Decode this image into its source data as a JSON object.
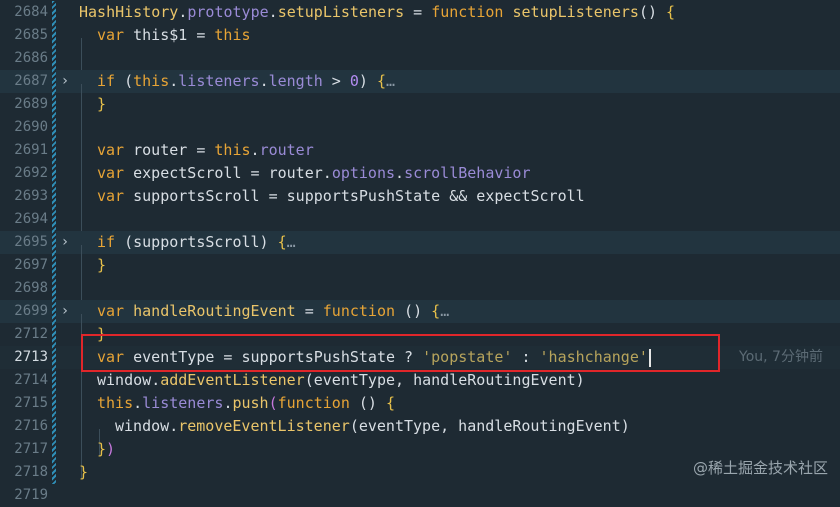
{
  "editor": {
    "lines": [
      {
        "num": "2684",
        "indent": 0,
        "fold": false,
        "tokens": [
          {
            "t": "HashHistory",
            "c": "fn"
          },
          {
            "t": ".",
            "c": "op"
          },
          {
            "t": "prototype",
            "c": "prop"
          },
          {
            "t": ".",
            "c": "op"
          },
          {
            "t": "setupListeners",
            "c": "fn"
          },
          {
            "t": " = ",
            "c": "op"
          },
          {
            "t": "function",
            "c": "kw"
          },
          {
            "t": " setupListeners",
            "c": "fn"
          },
          {
            "t": "() ",
            "c": "op"
          },
          {
            "t": "{",
            "c": "pn"
          }
        ]
      },
      {
        "num": "2685",
        "indent": 1,
        "fold": false,
        "tokens": [
          {
            "t": "var",
            "c": "kw"
          },
          {
            "t": " this$1 = ",
            "c": "id"
          },
          {
            "t": "this",
            "c": "kw"
          }
        ]
      },
      {
        "num": "2686",
        "indent": 1,
        "fold": false,
        "tokens": []
      },
      {
        "num": "2687",
        "indent": 1,
        "fold": true,
        "tokens": [
          {
            "t": "if",
            "c": "kw"
          },
          {
            "t": " (",
            "c": "op"
          },
          {
            "t": "this",
            "c": "kw"
          },
          {
            "t": ".",
            "c": "op"
          },
          {
            "t": "listeners",
            "c": "prop"
          },
          {
            "t": ".",
            "c": "op"
          },
          {
            "t": "length",
            "c": "prop"
          },
          {
            "t": " > ",
            "c": "op"
          },
          {
            "t": "0",
            "c": "num"
          },
          {
            "t": ") ",
            "c": "op"
          },
          {
            "t": "{",
            "c": "pn"
          },
          {
            "t": "…",
            "c": "dots"
          }
        ]
      },
      {
        "num": "2689",
        "indent": 1,
        "fold": false,
        "tokens": [
          {
            "t": "}",
            "c": "pn"
          }
        ]
      },
      {
        "num": "2690",
        "indent": 1,
        "fold": false,
        "tokens": []
      },
      {
        "num": "2691",
        "indent": 1,
        "fold": false,
        "tokens": [
          {
            "t": "var",
            "c": "kw"
          },
          {
            "t": " router = ",
            "c": "id"
          },
          {
            "t": "this",
            "c": "kw"
          },
          {
            "t": ".",
            "c": "op"
          },
          {
            "t": "router",
            "c": "prop"
          }
        ]
      },
      {
        "num": "2692",
        "indent": 1,
        "fold": false,
        "tokens": [
          {
            "t": "var",
            "c": "kw"
          },
          {
            "t": " expectScroll = router.",
            "c": "id"
          },
          {
            "t": "options",
            "c": "prop"
          },
          {
            "t": ".",
            "c": "op"
          },
          {
            "t": "scrollBehavior",
            "c": "prop"
          }
        ]
      },
      {
        "num": "2693",
        "indent": 1,
        "fold": false,
        "tokens": [
          {
            "t": "var",
            "c": "kw"
          },
          {
            "t": " supportsScroll = supportsPushState && expectScroll",
            "c": "id"
          }
        ]
      },
      {
        "num": "2694",
        "indent": 1,
        "fold": false,
        "tokens": []
      },
      {
        "num": "2695",
        "indent": 1,
        "fold": true,
        "tokens": [
          {
            "t": "if",
            "c": "kw"
          },
          {
            "t": " (supportsScroll) ",
            "c": "id"
          },
          {
            "t": "{",
            "c": "pn"
          },
          {
            "t": "…",
            "c": "dots"
          }
        ]
      },
      {
        "num": "2697",
        "indent": 1,
        "fold": false,
        "tokens": [
          {
            "t": "}",
            "c": "pn"
          }
        ]
      },
      {
        "num": "2698",
        "indent": 1,
        "fold": false,
        "tokens": []
      },
      {
        "num": "2699",
        "indent": 1,
        "fold": true,
        "tokens": [
          {
            "t": "var",
            "c": "kw"
          },
          {
            "t": " handleRoutingEvent",
            "c": "fn"
          },
          {
            "t": " = ",
            "c": "op"
          },
          {
            "t": "function",
            "c": "kw"
          },
          {
            "t": " () ",
            "c": "op"
          },
          {
            "t": "{",
            "c": "pn"
          },
          {
            "t": "…",
            "c": "dots"
          }
        ]
      },
      {
        "num": "2712",
        "indent": 1,
        "fold": false,
        "tokens": [
          {
            "t": "}",
            "c": "pn"
          }
        ]
      },
      {
        "num": "2713",
        "indent": 1,
        "fold": false,
        "current": true,
        "cursor": true,
        "blame": "You, 7分钟前",
        "tokens": [
          {
            "t": "var",
            "c": "kw"
          },
          {
            "t": " eventType = supportsPushState ? ",
            "c": "id"
          },
          {
            "t": "'popstate'",
            "c": "str"
          },
          {
            "t": " : ",
            "c": "op"
          },
          {
            "t": "'hashchange'",
            "c": "str"
          }
        ]
      },
      {
        "num": "2714",
        "indent": 1,
        "fold": false,
        "tokens": [
          {
            "t": "window",
            "c": "id"
          },
          {
            "t": ".",
            "c": "op"
          },
          {
            "t": "addEventListener",
            "c": "fn"
          },
          {
            "t": "(eventType, handleRoutingEvent)",
            "c": "id"
          }
        ]
      },
      {
        "num": "2715",
        "indent": 1,
        "fold": false,
        "tokens": [
          {
            "t": "this",
            "c": "kw"
          },
          {
            "t": ".",
            "c": "op"
          },
          {
            "t": "listeners",
            "c": "prop"
          },
          {
            "t": ".",
            "c": "op"
          },
          {
            "t": "push",
            "c": "fn"
          },
          {
            "t": "(",
            "c": "pn2"
          },
          {
            "t": "function",
            "c": "kw"
          },
          {
            "t": " () ",
            "c": "op"
          },
          {
            "t": "{",
            "c": "pn"
          }
        ]
      },
      {
        "num": "2716",
        "indent": 2,
        "fold": false,
        "tokens": [
          {
            "t": "window",
            "c": "id"
          },
          {
            "t": ".",
            "c": "op"
          },
          {
            "t": "removeEventListener",
            "c": "fn"
          },
          {
            "t": "(eventType, handleRoutingEvent)",
            "c": "id"
          }
        ]
      },
      {
        "num": "2717",
        "indent": 1,
        "fold": false,
        "tokens": [
          {
            "t": "}",
            "c": "pn"
          },
          {
            "t": ")",
            "c": "pn2"
          }
        ]
      },
      {
        "num": "2718",
        "indent": 0,
        "fold": false,
        "tokens": [
          {
            "t": "}",
            "c": "pn"
          }
        ]
      },
      {
        "num": "2719",
        "indent": 0,
        "fold": false,
        "tokens": []
      }
    ]
  },
  "watermark": "@稀土掘金技术社区",
  "colors": {
    "background": "#1e2a33",
    "keyword": "#e7a436",
    "function": "#eac56a",
    "property": "#9a8bd6",
    "string": "#b7a45c",
    "highlight_box": "#e0262a"
  },
  "icons": {
    "fold": "chevron-right-icon"
  }
}
